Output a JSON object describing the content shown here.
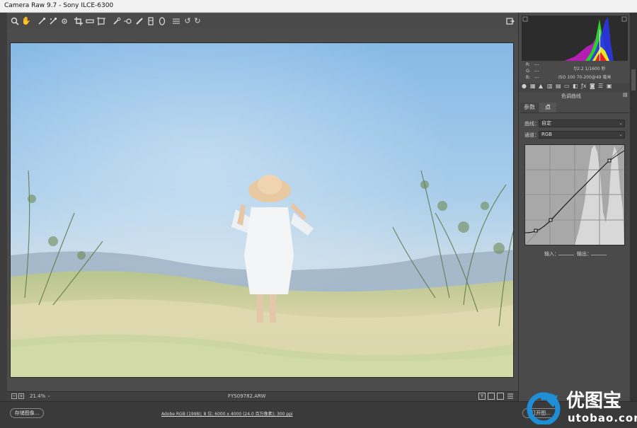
{
  "window": {
    "title": "Camera Raw 9.7  -  Sony ILCE-6300"
  },
  "histogram": {
    "rgb_labels": [
      "R:",
      "G:",
      "B:"
    ],
    "rgb_values": [
      "---",
      "---",
      "---"
    ],
    "exposure_line1": "f/2.2   1/1600 秒",
    "exposure_line2": "ISO 100   70-200@49 毫米"
  },
  "panel": {
    "title": "色调曲线",
    "tabs": [
      "参数",
      "点"
    ],
    "curve_label": "曲线：",
    "curve_value": "自定",
    "channel_label": "通道：",
    "channel_value": "RGB",
    "input_label": "输入：",
    "output_label": "输出："
  },
  "status": {
    "zoom": "21.4%",
    "filename": "FYS09782.ARW"
  },
  "bottom": {
    "save_button": "存储图像...",
    "workflow_link": "Adobe RGB (1998); 8 位; 6000 x 4000 (24.0 百万像素); 300 ppi",
    "open_button": "打开图..."
  },
  "watermark": {
    "brand": "优图宝",
    "url": "utobao.com"
  },
  "colors": {
    "accent": "#1e8fd6",
    "panel": "#4a4a4a",
    "titlebar": "#f2f2f2"
  }
}
